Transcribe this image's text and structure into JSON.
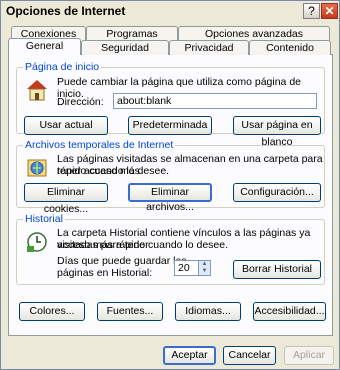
{
  "window": {
    "title": "Opciones de Internet",
    "help_glyph": "?",
    "close_glyph": "✕"
  },
  "tabs": {
    "row_back": [
      "Conexiones",
      "Programas",
      "Opciones avanzadas"
    ],
    "row_front": [
      "General",
      "Seguridad",
      "Privacidad",
      "Contenido"
    ],
    "active": "General"
  },
  "home_page": {
    "legend": "Página de inicio",
    "description": "Puede cambiar la página que utiliza como página de inicio.",
    "address_label": "Dirección:",
    "address_value": "about:blank",
    "btn_current": "Usar actual",
    "btn_default": "Predeterminada",
    "btn_blank": "Usar página en blanco"
  },
  "temp_files": {
    "legend": "Archivos temporales de Internet",
    "description_line1": "Las páginas visitadas se almacenan en una carpeta para tener acceso más",
    "description_line2": "rápido cuando lo desee.",
    "btn_cookies": "Eliminar cookies...",
    "btn_files": "Eliminar archivos...",
    "btn_settings": "Configuración..."
  },
  "history": {
    "legend": "Historial",
    "description_line1": "La carpeta Historial contiene vínculos a las páginas ya visitadas para tener",
    "description_line2": "acceso más rápido cuando lo desee.",
    "days_label_line1": "Días que puede guardar las",
    "days_label_line2": "páginas en Historial:",
    "days_value": "20",
    "btn_clear": "Borrar Historial"
  },
  "bottom_buttons": {
    "colors": "Colores...",
    "fonts": "Fuentes...",
    "languages": "Idiomas...",
    "accessibility": "Accesibilidad..."
  },
  "dialog_buttons": {
    "ok": "Aceptar",
    "cancel": "Cancelar",
    "apply": "Aplicar"
  }
}
